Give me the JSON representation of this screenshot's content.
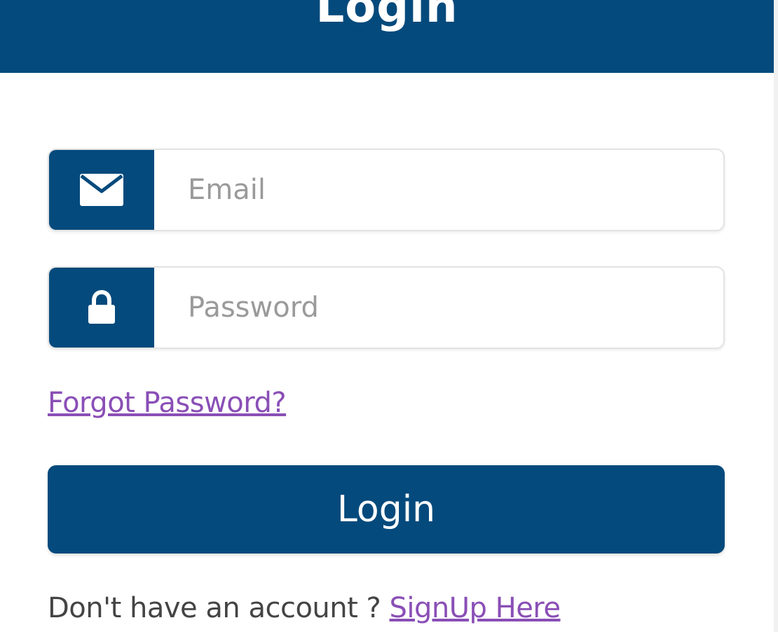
{
  "header": {
    "title": "Login"
  },
  "form": {
    "email": {
      "icon": "envelope-icon",
      "placeholder": "Email",
      "value": ""
    },
    "password": {
      "icon": "lock-icon",
      "placeholder": "Password",
      "value": ""
    },
    "forgot_password_label": "Forgot Password?",
    "login_button_label": "Login",
    "signup_prompt": "Don't have an account ?",
    "signup_link_label": "SignUp Here"
  },
  "colors": {
    "primary": "#044a7c",
    "link": "#8a4fb6",
    "placeholder": "#9a9a9a"
  }
}
